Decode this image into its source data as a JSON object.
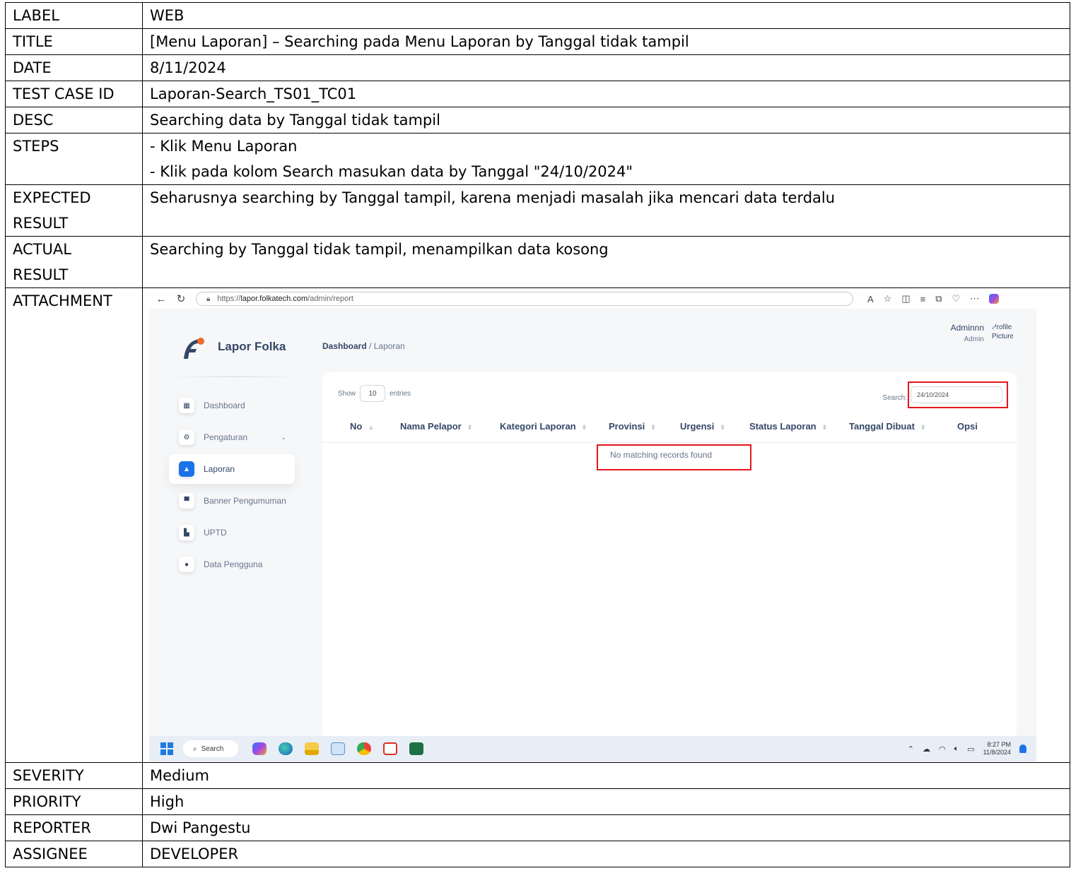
{
  "report": {
    "rows": [
      {
        "key": "LABEL",
        "value": "WEB"
      },
      {
        "key": "TITLE",
        "value": "[Menu Laporan] – Searching pada Menu Laporan by Tanggal tidak tampil"
      },
      {
        "key": "DATE",
        "value": "8/11/2024"
      },
      {
        "key": "TEST CASE ID",
        "value": "Laporan-Search_TS01_TC01"
      },
      {
        "key": "DESC",
        "value": "Searching data by Tanggal tidak tampil"
      }
    ],
    "steps": {
      "key": "STEPS",
      "lines": [
        "- Klik Menu Laporan",
        "- Klik pada kolom Search masukan data by Tanggal \"24/10/2024\""
      ]
    },
    "expected": {
      "key_line1": "EXPECTED",
      "key_line2": "RESULT",
      "value": "Seharusnya searching by Tanggal tampil, karena menjadi masalah jika mencari data terdalu"
    },
    "actual": {
      "key_line1": "ACTUAL",
      "key_line2": "RESULT",
      "value": "Searching by Tanggal tidak tampil, menampilkan data kosong"
    },
    "attachment_key": "ATTACHMENT",
    "tail_rows": [
      {
        "key": "SEVERITY",
        "value": "Medium"
      },
      {
        "key": "PRIORITY",
        "value": "High"
      },
      {
        "key": "REPORTER",
        "value": "Dwi Pangestu"
      },
      {
        "key": "ASSIGNEE",
        "value": "DEVELOPER"
      }
    ]
  },
  "screenshot": {
    "browser": {
      "url_prefix": "https://",
      "url_host": "lapor.folkatech.com",
      "url_path": "/admin/report",
      "icons": [
        "read-aloud-icon",
        "favorite-icon",
        "split-screen-icon",
        "favorites-bar-icon",
        "collections-icon",
        "extensions-icon",
        "more-icon",
        "copilot-icon"
      ]
    },
    "app": {
      "brand": "Lapor Folka",
      "brand_color": "#344767",
      "accent": "#1a73e8",
      "nav": [
        {
          "label": "Dashboard",
          "icon": "grid-icon",
          "active": false
        },
        {
          "label": "Pengaturan",
          "icon": "gear-icon",
          "active": false
        },
        {
          "label": "Laporan",
          "icon": "warning-icon",
          "active": true
        },
        {
          "label": "Banner Pengumuman",
          "icon": "announcement-icon",
          "active": false
        },
        {
          "label": "UPTD",
          "icon": "building-icon",
          "active": false
        },
        {
          "label": "Data Pengguna",
          "icon": "user-icon",
          "active": false
        }
      ],
      "breadcrumb": {
        "root": "Dashboard",
        "separator": "/",
        "current": "Laporan"
      },
      "profile": {
        "name": "Adminnn",
        "role": "Admin",
        "picture_alt": "Profile Picture"
      },
      "table": {
        "show_label": "Show",
        "entries_value": "10",
        "entries_label": "entries",
        "search_label": "Search:",
        "search_value": "24/10/2024",
        "columns": [
          "No",
          "Nama Pelapor",
          "Kategori Laporan",
          "Provinsi",
          "Urgensi",
          "Status Laporan",
          "Tanggal Dibuat",
          "Opsi"
        ],
        "empty_message": "No matching records found"
      },
      "highlight_color": "#e3161c"
    },
    "taskbar": {
      "search_label": "Search",
      "time": "8:27 PM",
      "date": "11/8/2024"
    }
  }
}
